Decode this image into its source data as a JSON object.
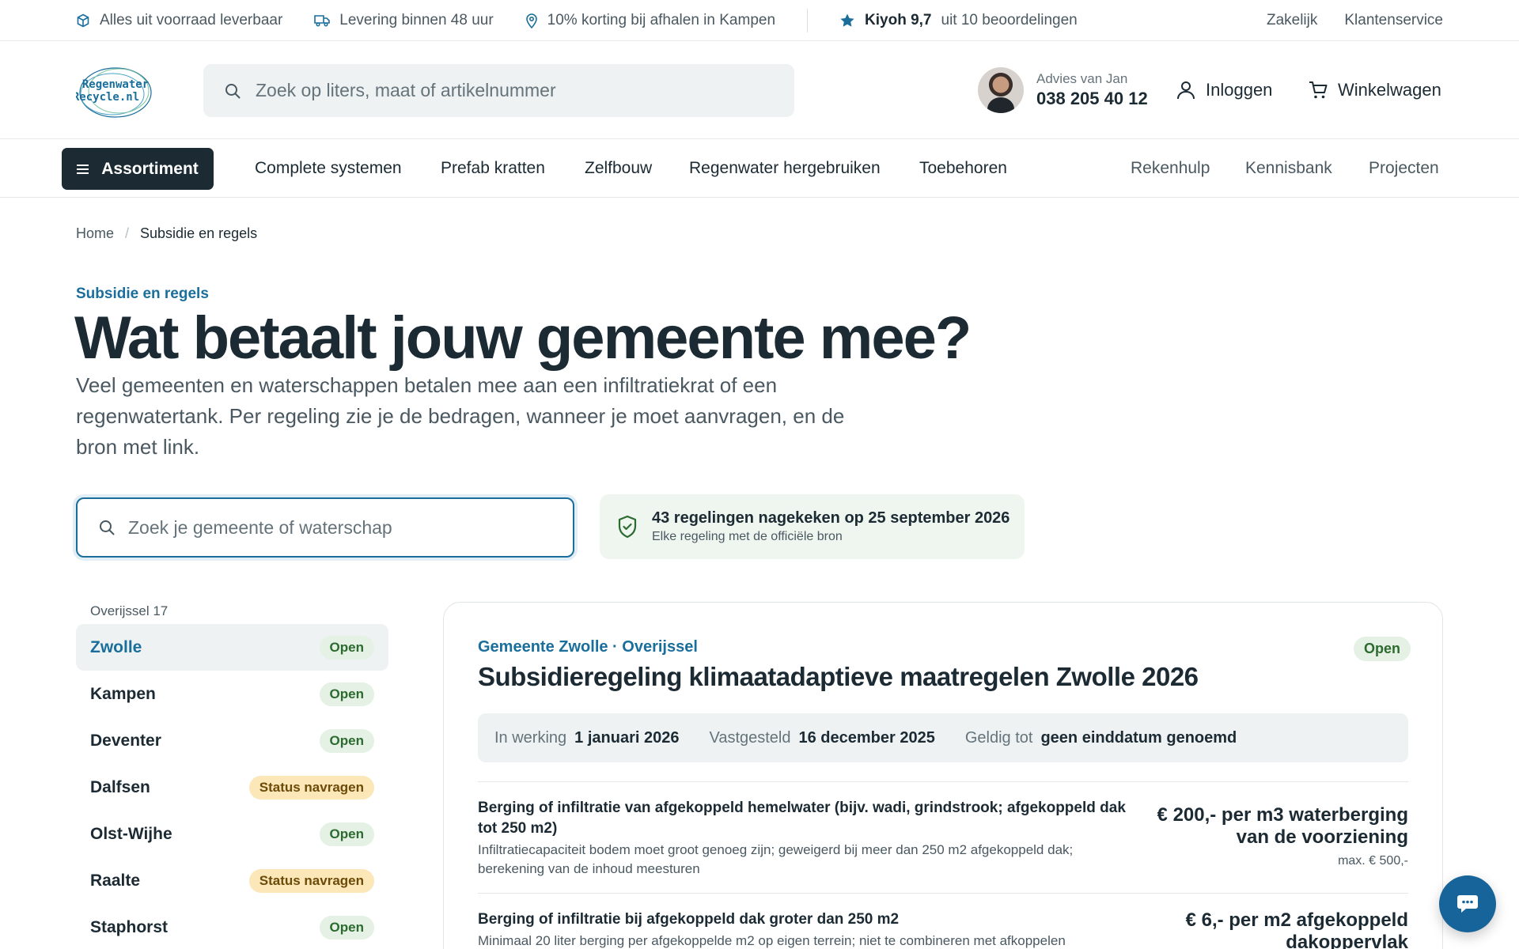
{
  "topbar": {
    "usps": [
      "Alles uit voorraad leverbaar",
      "Levering binnen 48 uur",
      "10% korting bij afhalen in Kampen"
    ],
    "kiyoh_score": "Kiyoh 9,7",
    "kiyoh_reviews": "uit 10 beoordelingen",
    "links": [
      "Zakelijk",
      "Klantenservice"
    ]
  },
  "header": {
    "logo_line1": "Regenwater",
    "logo_line2": "Recycle.nl",
    "search_placeholder": "Zoek op liters, maat of artikelnummer",
    "advice_label": "Advies van Jan",
    "advice_phone": "038 205 40 12",
    "login_label": "Inloggen",
    "cart_label": "Winkelwagen"
  },
  "nav": {
    "assortment_label": "Assortiment",
    "items": [
      "Complete systemen",
      "Prefab kratten",
      "Zelfbouw",
      "Regenwater hergebruiken",
      "Toebehoren"
    ],
    "secondary": [
      "Rekenhulp",
      "Kennisbank",
      "Projecten"
    ]
  },
  "breadcrumb": {
    "home": "Home",
    "separator": "/",
    "current": "Subsidie en regels"
  },
  "hero": {
    "eyebrow": "Subsidie en regels",
    "title": "Wat betaalt jouw gemeente mee?",
    "lede": "Veel gemeenten en waterschappen betalen mee aan een infiltratiekrat of een regenwatertank. Per regeling zie je de bedragen, wanneer je moet aanvragen, en de bron met link.",
    "search_placeholder": "Zoek je gemeente of waterschap",
    "verified_title": "43 regelingen nagekeken op 25 september 2026",
    "verified_sub": "Elke regeling met de officiële bron"
  },
  "regions": {
    "heading": "Overijssel 17",
    "items": [
      {
        "name": "Zwolle",
        "status": "Open",
        "status_type": "open",
        "active": true
      },
      {
        "name": "Kampen",
        "status": "Open",
        "status_type": "open"
      },
      {
        "name": "Deventer",
        "status": "Open",
        "status_type": "open"
      },
      {
        "name": "Dalfsen",
        "status": "Status navragen",
        "status_type": "ask"
      },
      {
        "name": "Olst-Wijhe",
        "status": "Open",
        "status_type": "open"
      },
      {
        "name": "Raalte",
        "status": "Status navragen",
        "status_type": "ask"
      },
      {
        "name": "Staphorst",
        "status": "Open",
        "status_type": "open"
      }
    ]
  },
  "detail": {
    "org": "Gemeente Zwolle · Overijssel",
    "status": "Open",
    "title": "Subsidieregeling klimaatadaptieve maatregelen Zwolle 2026",
    "meta": [
      {
        "key": "In werking",
        "value": "1 januari 2026"
      },
      {
        "key": "Vastgesteld",
        "value": "16 december 2025"
      },
      {
        "key": "Geldig tot",
        "value": "geen einddatum genoemd"
      }
    ],
    "rules": [
      {
        "title": "Berging of infiltratie van afgekoppeld hemelwater (bijv. wadi, grindstrook; afgekoppeld dak tot 250 m2)",
        "desc": "Infiltratiecapaciteit bodem moet groot genoeg zijn; geweigerd bij meer dan 250 m2 afgekoppeld dak; berekening van de inhoud meesturen",
        "amount": "€ 200,- per m3 waterberging van de voorziening",
        "max": "max. € 500,-"
      },
      {
        "title": "Berging of infiltratie bij afgekoppeld dak groter dan 250 m2",
        "desc": "Minimaal 20 liter berging per afgekoppelde m2 op eigen terrein; niet te combineren met afkoppelen",
        "amount": "€ 6,- per m2 afgekoppeld dakoppervlak",
        "max": ""
      }
    ]
  },
  "colors": {
    "brand": "#1a6e9c",
    "dark": "#1b2a33",
    "open_bg": "#e4f1e4",
    "ask_bg": "#fbe7b8"
  },
  "icons": {
    "chat": "chat-bubble-icon"
  }
}
